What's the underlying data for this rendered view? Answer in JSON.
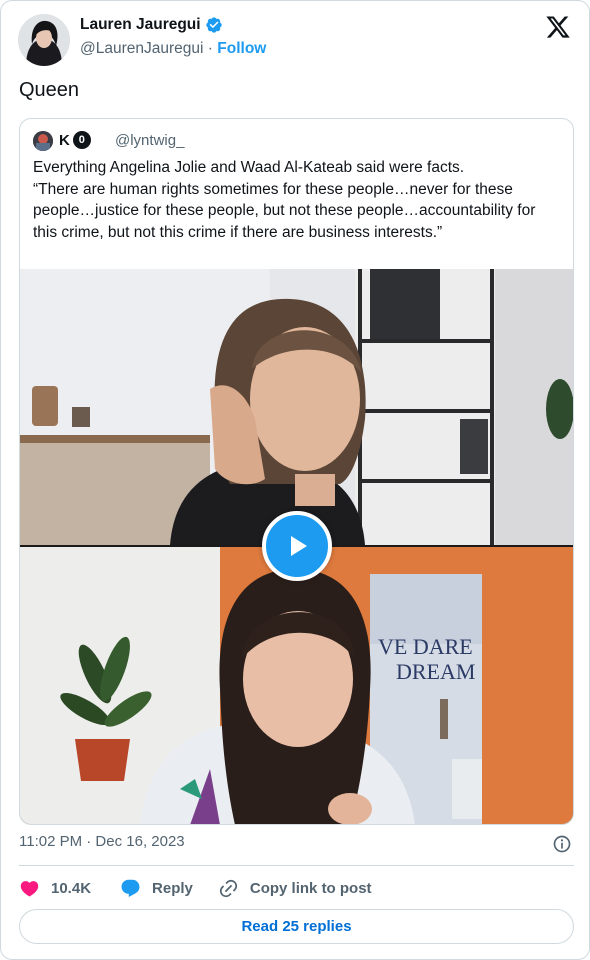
{
  "author": {
    "name": "Lauren Jauregui",
    "handle": "@LaurenJauregui",
    "separator": "·",
    "follow_label": "Follow"
  },
  "tweet": {
    "text": "Queen"
  },
  "quoted": {
    "name": "K",
    "badge": "0",
    "handle": "@lyntwig_",
    "text": "Everything Angelina Jolie and Waad Al-Kateab said were facts.\n“There are human rights sometimes for these people…never for these people…justice for these people, but not these people…accountability for this crime, but not this crime if there are business interests.”",
    "poster_text_line1": "VE DARE",
    "poster_text_line2": "DREAM"
  },
  "meta": {
    "timestamp": "11:02 PM · Dec 16, 2023"
  },
  "actions": {
    "like_count": "10.4K",
    "reply_label": "Reply",
    "copy_label": "Copy link to post"
  },
  "footer": {
    "read_replies_label": "Read 25 replies"
  },
  "colors": {
    "accent": "#1d9bf0",
    "like": "#f91880",
    "text_secondary": "#536471",
    "border": "#cfd9de"
  }
}
